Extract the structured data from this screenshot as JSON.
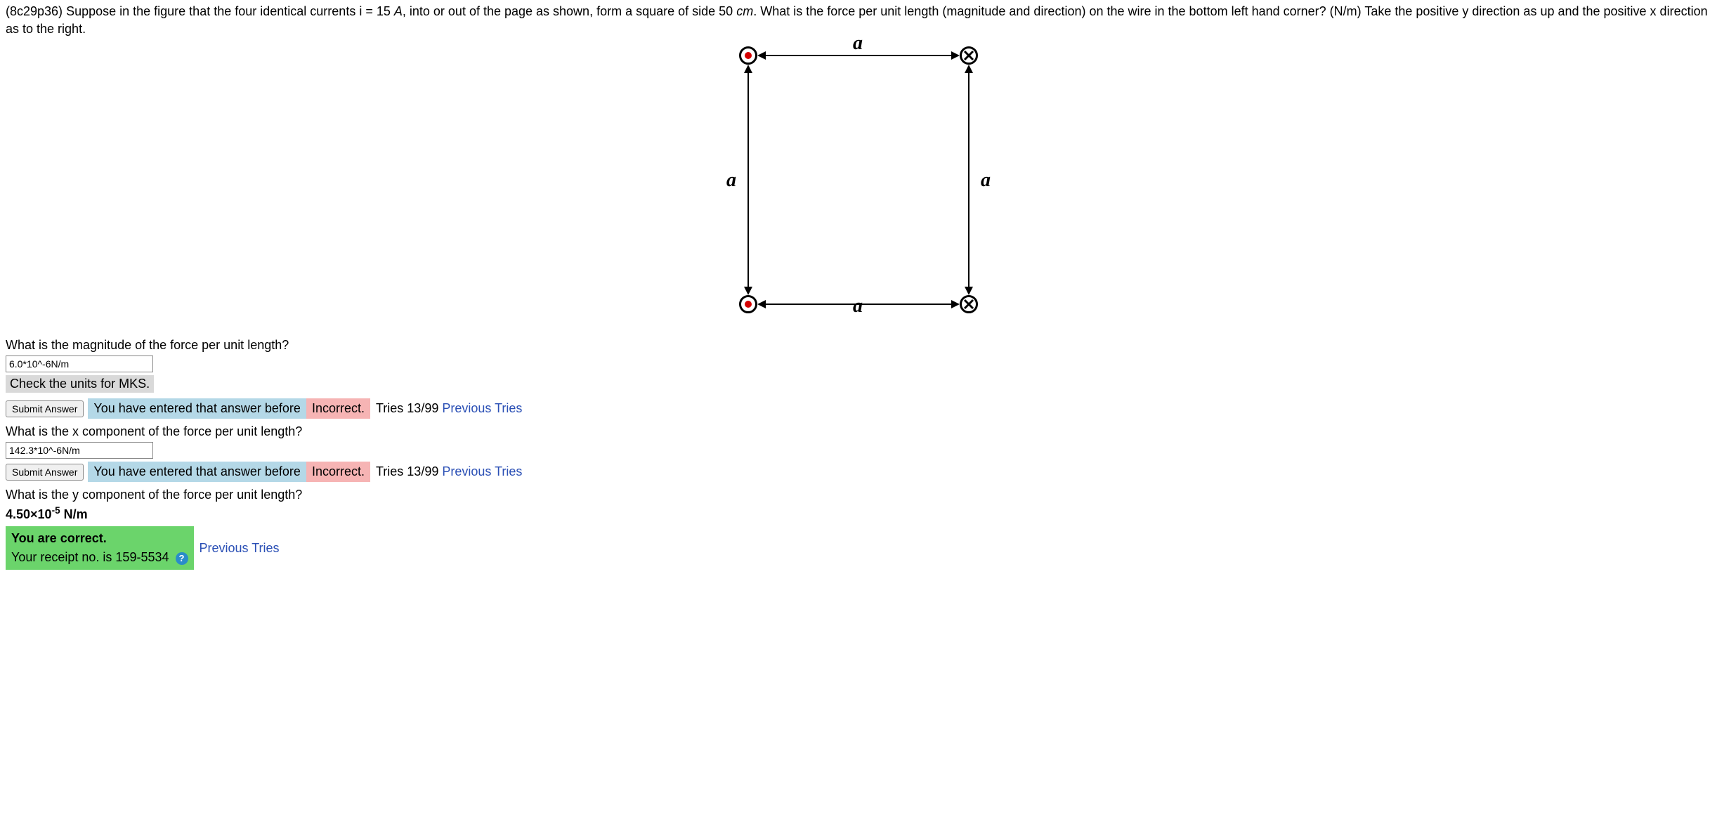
{
  "problem": {
    "id": "(8c29p36)",
    "text_before_i": " Suppose in the figure that the four identical currents i = ",
    "current_value": "15",
    "current_unit": "A",
    "text_mid": ", into or out of the page as shown, form a square of side ",
    "side_value": "50",
    "side_unit": "cm",
    "text_after": ". What is the force per unit length (magnitude and direction) on the wire in the bottom left hand corner? (N/m) Take the positive y direction as up and the positive x direction as to the right."
  },
  "figure": {
    "label": "a"
  },
  "q1": {
    "prompt": "What is the magnitude of the force per unit length?",
    "input_value": "6.0*10^-6N/m",
    "unit_feedback": "Check the units for MKS.",
    "submit_label": "Submit Answer",
    "entered_before": "You have entered that answer before",
    "incorrect": "Incorrect.",
    "tries": "Tries 13/99",
    "previous_tries": "Previous Tries"
  },
  "q2": {
    "prompt": "What is the x component of the force per unit length?",
    "input_value": "142.3*10^-6N/m",
    "submit_label": "Submit Answer",
    "entered_before": "You have entered that answer before",
    "incorrect": "Incorrect.",
    "tries": "Tries 13/99",
    "previous_tries": "Previous Tries"
  },
  "q3": {
    "prompt": "What is the y component of the force per unit length?",
    "answer_prefix": "4.50×10",
    "answer_exp": "-5",
    "answer_unit": " N/m",
    "correct_line1": "You are correct.",
    "correct_line2": "Your receipt no. is 159-5534",
    "previous_tries": "Previous Tries"
  }
}
